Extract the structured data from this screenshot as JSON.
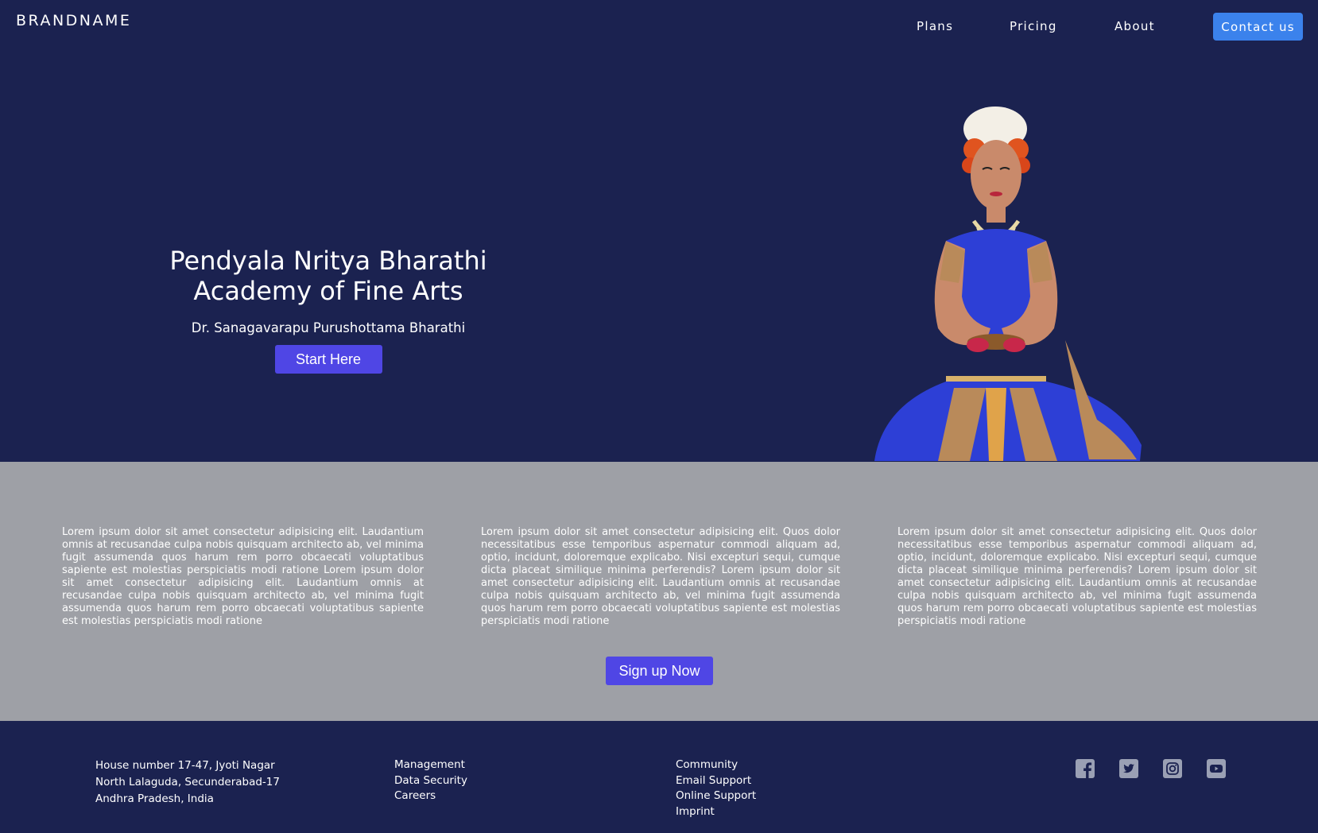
{
  "nav": {
    "brand": "BRANDNAME",
    "links": [
      "Plans",
      "Pricing",
      "About"
    ],
    "contact_label": "Contact us"
  },
  "hero": {
    "title_line1": "Pendyala Nritya Bharathi",
    "title_line2": "Academy of Fine Arts",
    "subtitle": "Dr. Sanagavarapu Purushottama Bharathi",
    "cta_label": "Start Here",
    "image": "classical-dancer-photo"
  },
  "content": {
    "paragraphs": [
      "Lorem ipsum dolor sit amet consectetur adipisicing elit. Laudantium omnis at recusandae culpa nobis quisquam architecto ab, vel minima fugit assumenda quos harum rem porro obcaecati voluptatibus sapiente est molestias perspiciatis modi ratione Lorem ipsum dolor sit amet consectetur adipisicing elit. Laudantium omnis at recusandae culpa nobis quisquam architecto ab, vel minima fugit assumenda quos harum rem porro obcaecati voluptatibus sapiente est molestias perspiciatis modi ratione",
      "Lorem ipsum dolor sit amet consectetur adipisicing elit. Quos dolor necessitatibus esse temporibus aspernatur commodi aliquam ad, optio, incidunt, doloremque explicabo. Nisi excepturi sequi, cumque dicta placeat similique minima perferendis? Lorem ipsum dolor sit amet consectetur adipisicing elit. Laudantium omnis at recusandae culpa nobis quisquam architecto ab, vel minima fugit assumenda quos harum rem porro obcaecati voluptatibus sapiente est molestias perspiciatis modi ratione",
      "Lorem ipsum dolor sit amet consectetur adipisicing elit. Quos dolor necessitatibus esse temporibus aspernatur commodi aliquam ad, optio, incidunt, doloremque explicabo. Nisi excepturi sequi, cumque dicta placeat similique minima perferendis? Lorem ipsum dolor sit amet consectetur adipisicing elit. Laudantium omnis at recusandae culpa nobis quisquam architecto ab, vel minima fugit assumenda quos harum rem porro obcaecati voluptatibus sapiente est molestias perspiciatis modi ratione"
    ],
    "signup_label": "Sign up Now"
  },
  "footer": {
    "address": [
      "House number 17-47, Jyoti Nagar",
      "North Lalaguda, Secunderabad-17",
      "Andhra Pradesh, India"
    ],
    "list1": [
      "Management",
      "Data Security",
      "Careers"
    ],
    "list2": [
      "Community",
      "Email Support",
      "Online Support",
      "Imprint"
    ],
    "social_icons": [
      "facebook-icon",
      "twitter-icon",
      "instagram-icon",
      "youtube-icon"
    ]
  },
  "colors": {
    "background": "#1b2250",
    "content_band": "#9ea0a6",
    "cta": "#4f46e5",
    "contact": "#3b82ec",
    "icon": "#9aa0b4"
  }
}
